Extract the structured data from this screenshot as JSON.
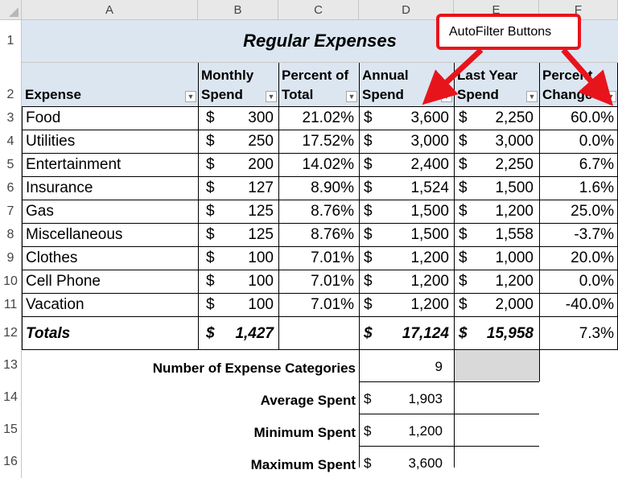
{
  "columns": [
    "A",
    "B",
    "C",
    "D",
    "E",
    "F"
  ],
  "rows": [
    "1",
    "2",
    "3",
    "4",
    "5",
    "6",
    "7",
    "8",
    "9",
    "10",
    "11",
    "12",
    "13",
    "14",
    "15",
    "16"
  ],
  "title": "Regular Expenses",
  "headers": {
    "expense": "Expense",
    "monthly_line1": "Monthly",
    "monthly_line2": "Spend",
    "pct_line1": "Percent of",
    "pct_line2": "Total",
    "annual_line1": "Annual",
    "annual_line2": "Spend",
    "lastyear_line1": "Last Year",
    "lastyear_line2": "Spend",
    "change_line1": "Percent",
    "change_line2": "Change"
  },
  "currency": "$",
  "data_rows": [
    {
      "expense": "Food",
      "monthly": "300",
      "pct": "21.02%",
      "annual": "3,600",
      "last": "2,250",
      "change": "60.0%"
    },
    {
      "expense": "Utilities",
      "monthly": "250",
      "pct": "17.52%",
      "annual": "3,000",
      "last": "3,000",
      "change": "0.0%"
    },
    {
      "expense": "Entertainment",
      "monthly": "200",
      "pct": "14.02%",
      "annual": "2,400",
      "last": "2,250",
      "change": "6.7%"
    },
    {
      "expense": "Insurance",
      "monthly": "127",
      "pct": "8.90%",
      "annual": "1,524",
      "last": "1,500",
      "change": "1.6%"
    },
    {
      "expense": "Gas",
      "monthly": "125",
      "pct": "8.76%",
      "annual": "1,500",
      "last": "1,200",
      "change": "25.0%"
    },
    {
      "expense": "Miscellaneous",
      "monthly": "125",
      "pct": "8.76%",
      "annual": "1,500",
      "last": "1,558",
      "change": "-3.7%"
    },
    {
      "expense": "Clothes",
      "monthly": "100",
      "pct": "7.01%",
      "annual": "1,200",
      "last": "1,000",
      "change": "20.0%"
    },
    {
      "expense": "Cell Phone",
      "monthly": "100",
      "pct": "7.01%",
      "annual": "1,200",
      "last": "1,200",
      "change": "0.0%"
    },
    {
      "expense": "Vacation",
      "monthly": "100",
      "pct": "7.01%",
      "annual": "1,200",
      "last": "2,000",
      "change": "-40.0%"
    }
  ],
  "totals": {
    "label": "Totals",
    "monthly": "1,427",
    "annual": "17,124",
    "last": "15,958",
    "change": "7.3%"
  },
  "stats": [
    {
      "label": "Number of Expense Categories",
      "value": "9",
      "has_dollar": false
    },
    {
      "label": "Average Spent",
      "value": "1,903",
      "has_dollar": true
    },
    {
      "label": "Minimum Spent",
      "value": "1,200",
      "has_dollar": true
    },
    {
      "label": "Maximum Spent",
      "value": "3,600",
      "has_dollar": true
    }
  ],
  "callout": {
    "text": "AutoFilter Buttons",
    "color": "#e8141b"
  },
  "colors": {
    "header_fill": "#dce6f1",
    "highlight_fill": "#d9d9d9",
    "arrow": "#e8141b"
  }
}
